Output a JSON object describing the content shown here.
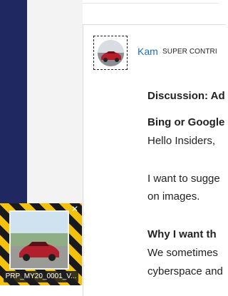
{
  "author": {
    "name": "Kam",
    "rank": "SUPER CONTRI"
  },
  "post": {
    "lines": [
      "Discussion: Ad",
      "Bing or Google",
      "Hello Insiders,",
      "I want to sugge",
      "on images.",
      "Why I want th",
      "We sometimes",
      "cyberspace and"
    ]
  },
  "thumbnail": {
    "filename": "PRP_MY20_0001_V...",
    "close_glyph": "✕"
  },
  "icons": {
    "avatar": "avatar-icon",
    "close": "close-icon"
  },
  "colors": {
    "sidebar": "#1f2860",
    "link": "#1a6fc4",
    "hazard_yellow": "#f4c20d",
    "hazard_black": "#1a1a1a"
  }
}
